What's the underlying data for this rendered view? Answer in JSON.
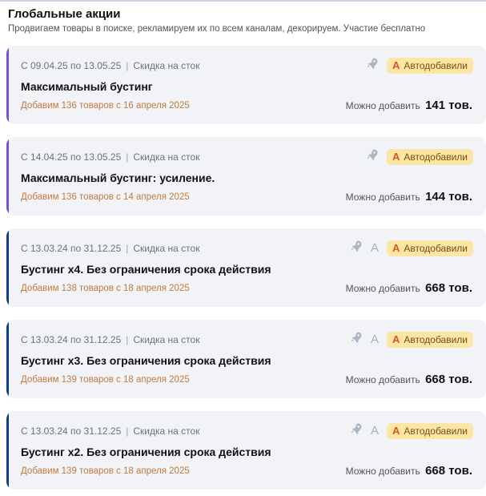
{
  "header": {
    "title": "Глобальные акции",
    "subtitle": "Продвигаем товары в поиске, рекламируем их по всем каналам, декорируем. Участие бесплатно"
  },
  "colors": {
    "purple_stripe": "#7c4fd6",
    "blue_stripe": "#0f3f8c",
    "badge_bg": "#fbe6a6",
    "added_text": "#c07a3e"
  },
  "promotions": [
    {
      "dates": "С 09.04.25 по 13.05.25",
      "type": "Скидка на сток",
      "name": "Максимальный бустинг",
      "added": "Добавим 136 товаров с 16 апреля 2025",
      "can_add_label": "Можно добавить",
      "can_add_count": "141 тов.",
      "badge": "Автодобавили",
      "badge_letter": "А",
      "stripe": "purple",
      "has_a_icon": false,
      "a_icon": ""
    },
    {
      "dates": "С 14.04.25 по 13.05.25",
      "type": "Скидка на сток",
      "name": "Максимальный бустинг: усиление.",
      "added": "Добавим 136 товаров с 14 апреля 2025",
      "can_add_label": "Можно добавить",
      "can_add_count": "144 тов.",
      "badge": "Автодобавили",
      "badge_letter": "А",
      "stripe": "purple",
      "has_a_icon": false,
      "a_icon": ""
    },
    {
      "dates": "С 13.03.24 по 31.12.25",
      "type": "Скидка на сток",
      "name": "Бустинг x4. Без ограничения срока действия",
      "added": "Добавим 138 товаров с 18 апреля 2025",
      "can_add_label": "Можно добавить",
      "can_add_count": "668 тов.",
      "badge": "Автодобавили",
      "badge_letter": "А",
      "stripe": "blue",
      "has_a_icon": true,
      "a_icon": "A"
    },
    {
      "dates": "С 13.03.24 по 31.12.25",
      "type": "Скидка на сток",
      "name": "Бустинг x3. Без ограничения срока действия",
      "added": "Добавим 139 товаров с 18 апреля 2025",
      "can_add_label": "Можно добавить",
      "can_add_count": "668 тов.",
      "badge": "Автодобавили",
      "badge_letter": "А",
      "stripe": "blue",
      "has_a_icon": true,
      "a_icon": "A"
    },
    {
      "dates": "С 13.03.24 по 31.12.25",
      "type": "Скидка на сток",
      "name": "Бустинг x2. Без ограничения срока действия",
      "added": "Добавим 139 товаров с 18 апреля 2025",
      "can_add_label": "Можно добавить",
      "can_add_count": "668 тов.",
      "badge": "Автодобавили",
      "badge_letter": "А",
      "stripe": "blue",
      "has_a_icon": true,
      "a_icon": "A"
    }
  ]
}
